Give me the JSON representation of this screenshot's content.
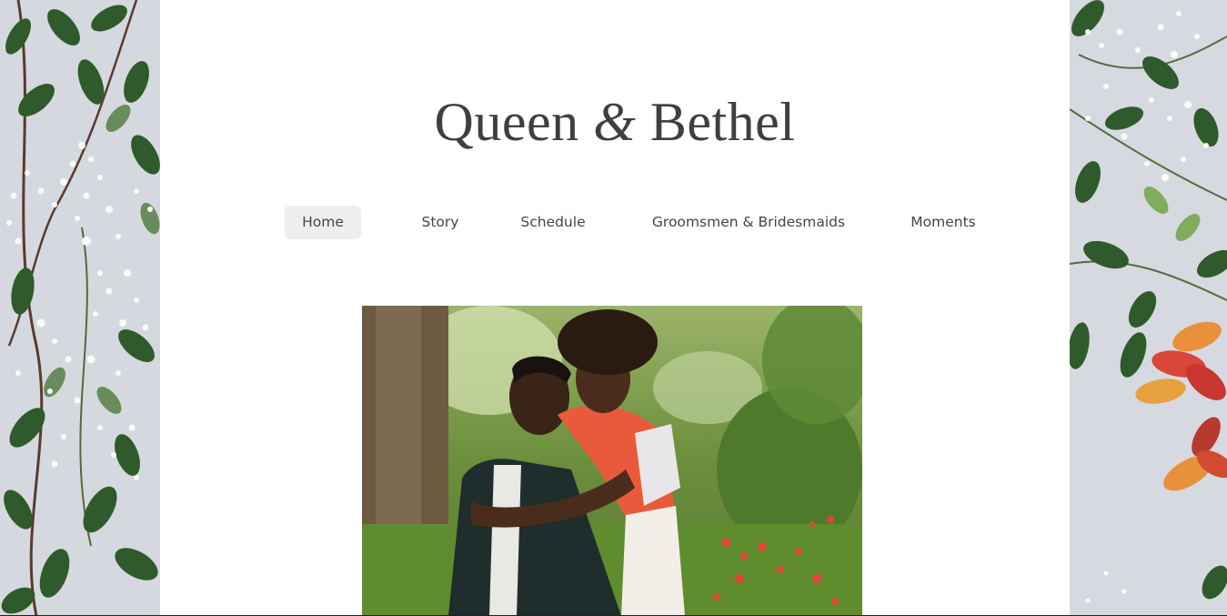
{
  "site": {
    "title_part1": "Queen",
    "title_amp": "&",
    "title_part2": "Bethel"
  },
  "nav": {
    "items": [
      {
        "label": "Home",
        "active": true
      },
      {
        "label": "Story",
        "active": false
      },
      {
        "label": "Schedule",
        "active": false
      },
      {
        "label": "Groomsmen & Bridesmaids",
        "active": false
      },
      {
        "label": "Moments",
        "active": false
      }
    ]
  },
  "colors": {
    "title": "#3f3f3f",
    "nav_active_bg": "#eeeeee",
    "page_bg": "#ffffff",
    "side_bg": "#d7d9e0"
  },
  "hero_photo": {
    "icon": "couple-photo"
  }
}
